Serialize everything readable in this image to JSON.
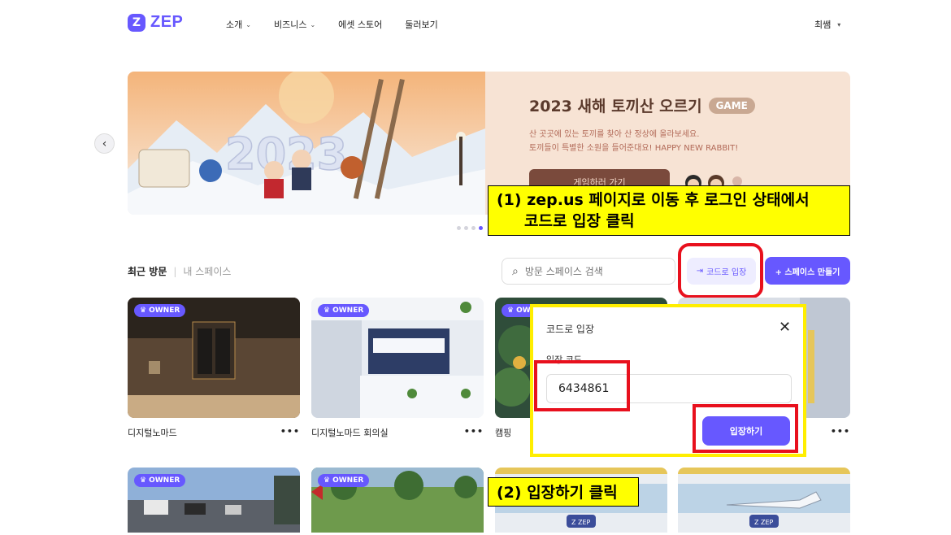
{
  "header": {
    "logo_mark": "Z",
    "logo_text": "ZEP",
    "nav": [
      {
        "label": "소개",
        "has_dropdown": true
      },
      {
        "label": "비즈니스",
        "has_dropdown": true
      },
      {
        "label": "에셋 스토어",
        "has_dropdown": false
      },
      {
        "label": "둘러보기",
        "has_dropdown": false
      }
    ],
    "user_name": "최쌤"
  },
  "banner": {
    "title": "2023 새해 토끼산 오르기",
    "badge": "GAME",
    "desc_line1": "산 곳곳에 있는 토끼를 찾아 산 정상에 올라보세요.",
    "desc_line2": "토끼들이 특별한 소원을 들어준대요! HAPPY NEW RABBIT!",
    "button": "게임하러 가기",
    "art_text": "2023"
  },
  "tabs": {
    "recent": "최근 방문",
    "mine": "내 스페이스"
  },
  "search": {
    "placeholder": "방문 스페이스 검색"
  },
  "actions": {
    "enter_code": "코드로 입장",
    "create_space": "+ 스페이스 만들기"
  },
  "cards_row1": [
    {
      "title": "디지털노마드",
      "badge": "OWNER"
    },
    {
      "title": "디지털노마드 회의실",
      "badge": "OWNER"
    },
    {
      "title": "캠핑",
      "badge": "OW"
    }
  ],
  "cards_row2": [
    {
      "badge": "OWNER"
    },
    {
      "badge": "OWNER"
    }
  ],
  "modal": {
    "title": "코드로 입장",
    "label": "입장 코드",
    "code_value": "6434861",
    "submit": "입장하기"
  },
  "annotations": {
    "step1_line1": "(1) zep.us 페이지로 이동 후 로그인 상태에서",
    "step1_line2": "코드로 입장 클릭",
    "step2": "(2) 입장하기 클릭"
  },
  "colors": {
    "brand": "#6758ff",
    "highlight_yellow": "#ffff00",
    "highlight_red": "#e8101d"
  }
}
